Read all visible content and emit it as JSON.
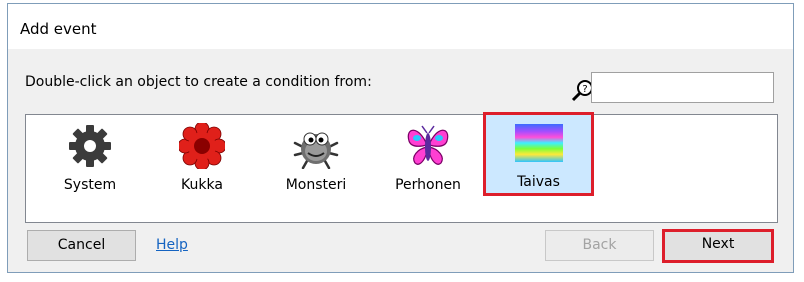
{
  "dialog": {
    "title": "Add event",
    "instruction": "Double-click an object to create a condition from:",
    "search": {
      "value": "",
      "placeholder": ""
    },
    "objects": [
      {
        "label": "System",
        "icon": "gear-icon",
        "selected": false
      },
      {
        "label": "Kukka",
        "icon": "flower-icon",
        "selected": false
      },
      {
        "label": "Monsteri",
        "icon": "monster-icon",
        "selected": false
      },
      {
        "label": "Perhonen",
        "icon": "butterfly-icon",
        "selected": false
      },
      {
        "label": "Taivas",
        "icon": "sky-icon",
        "selected": true
      }
    ],
    "buttons": {
      "cancel": "Cancel",
      "help": "Help",
      "back": "Back",
      "next": "Next"
    },
    "colors": {
      "highlight": "#dd1e2b",
      "link": "#1463c1"
    }
  }
}
